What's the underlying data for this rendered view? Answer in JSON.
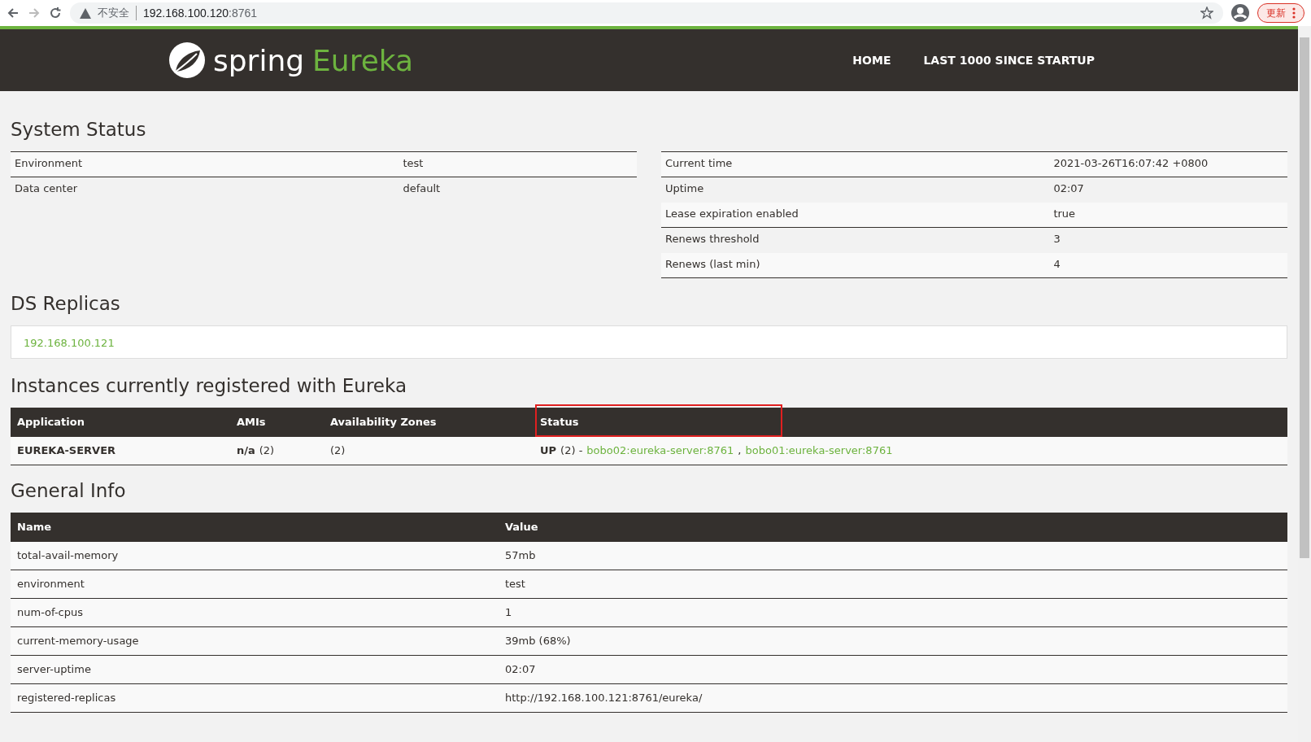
{
  "browser": {
    "security_label": "不安全",
    "url_host": "192.168.100.120",
    "url_port": ":8761",
    "update_button": "更新"
  },
  "navbar": {
    "brand_word": "spring",
    "brand_product": "Eureka",
    "links": [
      "HOME",
      "LAST 1000 SINCE STARTUP"
    ]
  },
  "system_status": {
    "title": "System Status",
    "left_rows": [
      {
        "label": "Environment",
        "value": "test"
      },
      {
        "label": "Data center",
        "value": "default"
      }
    ],
    "right_rows": [
      {
        "label": "Current time",
        "value": "2021-03-26T16:07:42 +0800"
      },
      {
        "label": "Uptime",
        "value": "02:07"
      },
      {
        "label": "Lease expiration enabled",
        "value": "true"
      },
      {
        "label": "Renews threshold",
        "value": "3"
      },
      {
        "label": "Renews (last min)",
        "value": "4"
      }
    ]
  },
  "ds_replicas": {
    "title": "DS Replicas",
    "items": [
      "192.168.100.121"
    ]
  },
  "instances": {
    "title": "Instances currently registered with Eureka",
    "columns": [
      {
        "label": "Application",
        "highlighted": false
      },
      {
        "label": "AMIs",
        "highlighted": false
      },
      {
        "label": "Availability Zones",
        "highlighted": false
      },
      {
        "label": "Status",
        "highlighted": true
      }
    ],
    "rows": [
      {
        "application": "EUREKA-SERVER",
        "ami": "n/a",
        "ami_count": "(2)",
        "zones": "(2)",
        "status": "UP",
        "status_count": "(2) -",
        "links": [
          "bobo02:eureka-server:8761",
          "bobo01:eureka-server:8761"
        ],
        "separator": ","
      }
    ]
  },
  "general_info": {
    "title": "General Info",
    "columns": [
      "Name",
      "Value"
    ],
    "rows": [
      {
        "name": "total-avail-memory",
        "value": "57mb"
      },
      {
        "name": "environment",
        "value": "test"
      },
      {
        "name": "num-of-cpus",
        "value": "1"
      },
      {
        "name": "current-memory-usage",
        "value": "39mb (68%)"
      },
      {
        "name": "server-uptime",
        "value": "02:07"
      },
      {
        "name": "registered-replicas",
        "value": "http://192.168.100.121:8761/eureka/"
      }
    ]
  }
}
